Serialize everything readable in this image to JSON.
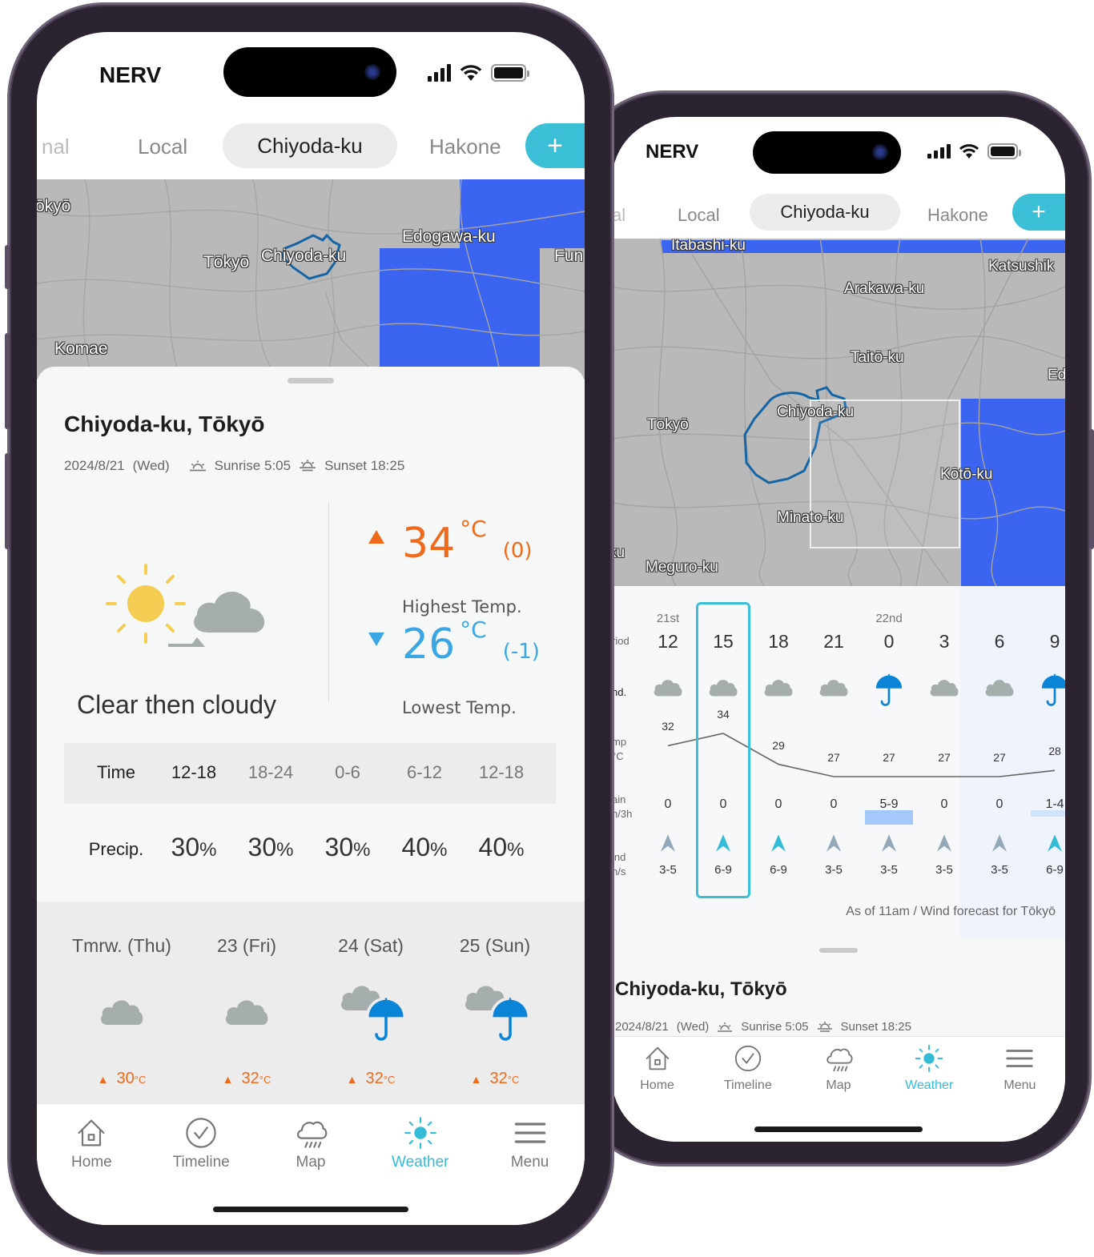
{
  "status_bar": {
    "carrier": "NERV"
  },
  "tabs": {
    "items": [
      {
        "label": "nal",
        "state": "faded"
      },
      {
        "label": "Local",
        "state": "inactive"
      },
      {
        "label": "Chiyoda-ku",
        "state": "active"
      },
      {
        "label": "Hakone",
        "state": "inactive"
      }
    ],
    "right_items": [
      {
        "label": "al",
        "state": "faded"
      },
      {
        "label": "Local",
        "state": "inactive"
      },
      {
        "label": "Chiyoda-ku",
        "state": "active"
      },
      {
        "label": "Hakone",
        "state": "inactive"
      }
    ],
    "add_label": "+"
  },
  "left_map": {
    "labels": [
      "ōkyō",
      "Tōkyō",
      "Chiyoda-ku",
      "Edogawa-ku",
      "Fun",
      "Komae"
    ]
  },
  "right_map": {
    "labels": [
      "Itabashi-ku",
      "Katsushik",
      "Arakawa-ku",
      "Taitō-ku",
      "Ed",
      "Tōkyō",
      "Chiyoda-ku",
      "Kōtō-ku",
      "Minato-ku",
      "Meguro-ku",
      "ku"
    ]
  },
  "location": {
    "title": "Chiyoda-ku, Tōkyō",
    "date": "2024/8/21",
    "weekday": "(Wed)",
    "sunrise": "Sunrise 5:05",
    "sunset": "Sunset 18:25"
  },
  "today": {
    "description": "Clear then cloudy",
    "icon": "sun-then-cloud-icon",
    "high": {
      "value": "34",
      "unit": "°C",
      "diff": "(0)",
      "label": "Highest Temp."
    },
    "low": {
      "value": "26",
      "unit": "°C",
      "diff": "(-1)",
      "label": "Lowest Temp."
    }
  },
  "precip_table": {
    "time_label": "Time",
    "precip_label": "Precip.",
    "columns": [
      {
        "time": "12-18",
        "precip": "30",
        "unit": "%"
      },
      {
        "time": "18-24",
        "precip": "30",
        "unit": "%"
      },
      {
        "time": "0-6",
        "precip": "30",
        "unit": "%"
      },
      {
        "time": "6-12",
        "precip": "40",
        "unit": "%"
      },
      {
        "time": "12-18",
        "precip": "40",
        "unit": "%"
      }
    ]
  },
  "weekly": [
    {
      "label": "Tmrw. (Thu)",
      "icon": "cloud-icon",
      "high": "30",
      "unit": "°C"
    },
    {
      "label": "23 (Fri)",
      "icon": "cloud-icon",
      "high": "32",
      "unit": "°C"
    },
    {
      "label": "24 (Sat)",
      "icon": "cloud-rain-icon",
      "high": "32",
      "unit": "°C"
    },
    {
      "label": "25 (Sun)",
      "icon": "cloud-rain-icon",
      "high": "32",
      "unit": "°C"
    }
  ],
  "tabbar": {
    "items": [
      {
        "label": "Home",
        "icon": "home-icon",
        "active": false
      },
      {
        "label": "Timeline",
        "icon": "timeline-check-icon",
        "active": false
      },
      {
        "label": "Map",
        "icon": "map-rain-cloud-icon",
        "active": false
      },
      {
        "label": "Weather",
        "icon": "weather-sun-icon",
        "active": true
      },
      {
        "label": "Menu",
        "icon": "menu-icon",
        "active": false
      }
    ]
  },
  "hourly": {
    "row_labels": {
      "period": "riod",
      "cond": "nd.",
      "temp": "mp\n°C",
      "rain": "ain\nn/3h",
      "wind": "ind\nn/s"
    },
    "selected_index": 1,
    "columns": [
      {
        "day": "21st",
        "hour": "12",
        "cond": "cloud",
        "temp": 32,
        "rain": "0",
        "rain_level": 0,
        "wind": "3-5",
        "wind_strong": false
      },
      {
        "day": "",
        "hour": "15",
        "cond": "cloud",
        "temp": 34,
        "rain": "0",
        "rain_level": 0,
        "wind": "6-9",
        "wind_strong": true
      },
      {
        "day": "",
        "hour": "18",
        "cond": "cloud",
        "temp": 29,
        "rain": "0",
        "rain_level": 0,
        "wind": "6-9",
        "wind_strong": true
      },
      {
        "day": "",
        "hour": "21",
        "cond": "cloud",
        "temp": 27,
        "rain": "0",
        "rain_level": 0,
        "wind": "3-5",
        "wind_strong": false
      },
      {
        "day": "22nd",
        "hour": "0",
        "cond": "rain",
        "temp": 27,
        "rain": "5-9",
        "rain_level": 2,
        "wind": "3-5",
        "wind_strong": false
      },
      {
        "day": "",
        "hour": "3",
        "cond": "cloud",
        "temp": 27,
        "rain": "0",
        "rain_level": 0,
        "wind": "3-5",
        "wind_strong": false
      },
      {
        "day": "",
        "hour": "6",
        "cond": "cloud",
        "temp": 27,
        "rain": "0",
        "rain_level": 0,
        "wind": "3-5",
        "wind_strong": false
      },
      {
        "day": "",
        "hour": "9",
        "cond": "rain",
        "temp": 28,
        "rain": "1-4",
        "rain_level": 1,
        "wind": "6-9",
        "wind_strong": true
      }
    ],
    "note": "As of 11am / Wind forecast for Tōkyō"
  },
  "colors": {
    "accent": "#34bcd6",
    "high_temp": "#f06a1c",
    "low_temp": "#3aa6e4",
    "rain_blue": "#0a84d6",
    "cloud_gray": "#a6adad",
    "sun_yellow": "#f5cd52",
    "map_blue": "#3b64f0",
    "wind_gray": "#94a9b8"
  }
}
